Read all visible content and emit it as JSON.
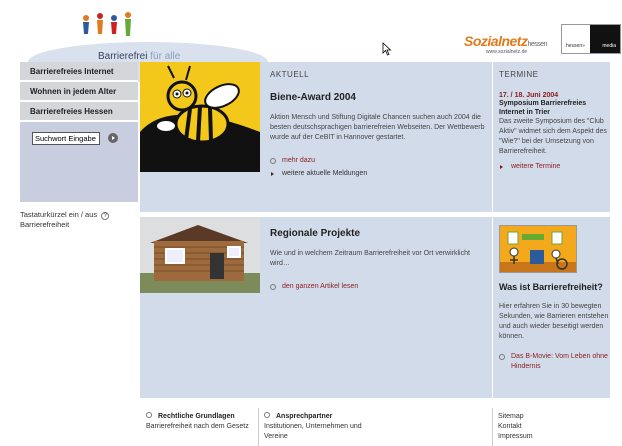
{
  "header": {
    "logo_text_bold": "Barrierefrei",
    "logo_text_light": " für alle",
    "partner1_name": "Sozialnetz",
    "partner1_suffix": "hessen",
    "partner1_url": "www.sozialnetz.de",
    "partner2_left": "hessen»",
    "partner2_right": "media"
  },
  "sidebar": {
    "items": [
      {
        "label": "Barrierefreies Internet"
      },
      {
        "label": "Wohnen in jedem Alter"
      },
      {
        "label": "Barrierefreies Hessen"
      }
    ],
    "search_value": "Suchwort Eingabe",
    "shortcut_line1": "Tastaturkürzel ein / aus",
    "shortcut_line2": "Barrierefreiheit",
    "shortcut_icon": "?"
  },
  "news": {
    "section_label": "AKTUELL",
    "title": "Biene-Award 2004",
    "text": "Aktion Mensch und Stiftung Digitale Chancen suchen auch 2004 die besten deutschsprachigen barrierefreien Webseiten. Der Wettbewerb wurde auf der CeBIT in Hannover gestartet.",
    "more_link": "mehr dazu",
    "more_news_link": "weitere aktuelle Meldungen"
  },
  "termine": {
    "section_label": "TERMINE",
    "date": "17. / 18. Juni 2004",
    "title": "Symposium Barrierefreies Internet in Trier",
    "text": "Das zweite Symposium des \"Club Aktiv\" widmet sich dem Aspekt des \"Wie?\" bei der Umsetzung von Barrierefreiheit.",
    "more_link": "weitere Termine"
  },
  "projects": {
    "title": "Regionale Projekte",
    "text": "Wie und in welchem Zeitraum Barrierefreiheit vor Ort verwirklicht wird…",
    "link": "den ganzen Artikel lesen"
  },
  "movie": {
    "question": "Was ist Barrierefreiheit?",
    "text": "Hier erfahren Sie in 30 bewegten Sekunden, wie Barrieren entstehen und auch wieder beseitigt werden können.",
    "link": "Das B-Movie: Vom Leben ohne Hindernis"
  },
  "footer": {
    "col1_title": "Rechtliche Grundlagen",
    "col1_text": "Barrierefreiheit nach dem Gesetz",
    "col2_title": "Ansprechpartner",
    "col2_text": "Institutionen, Unternehmen und Vereine",
    "col3_items": [
      "Sitemap",
      "Kontakt",
      "Impressum"
    ]
  },
  "colors": {
    "panel": "#d2dbea",
    "link_red": "#8a1c1c",
    "nav_grey": "#d4d6da",
    "bee_yellow": "#f3c81a",
    "sozial_orange": "#e07a1f"
  }
}
